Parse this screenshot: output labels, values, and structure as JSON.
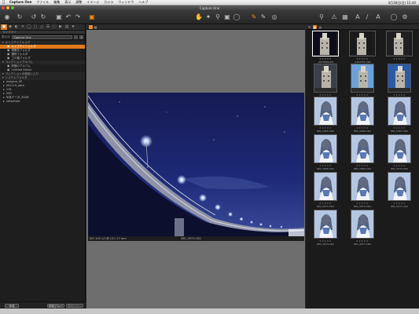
{
  "menubar": {
    "items": [
      "Capture One",
      "ファイル",
      "編集",
      "表示",
      "調整",
      "イメージ",
      "カメラ",
      "ウィンドウ",
      "ヘルプ"
    ],
    "clock": "4月18日(日) 15:40"
  },
  "window": {
    "title": "Capture One"
  },
  "left_panel": {
    "section_label": "ライブラリ",
    "combo_label": "表示元",
    "combo_value": "Capture One",
    "library": [
      {
        "type": "head",
        "label": "キャプチャフォルダ"
      },
      {
        "type": "item",
        "label": "キャプチャフォルダ",
        "selected": true
      },
      {
        "type": "item",
        "label": "現像先フォルダ"
      },
      {
        "type": "item",
        "label": "選択フォルダ"
      },
      {
        "type": "item",
        "label": "ゴミ箱フォルダ"
      },
      {
        "type": "head",
        "label": "コレクションアルバム"
      },
      {
        "type": "item",
        "label": "評価のアルバム"
      },
      {
        "type": "item",
        "label": "Untitled Album"
      },
      {
        "type": "head",
        "label": "コレクションの追加に入力"
      },
      {
        "type": "head",
        "label": "システムフォルダ"
      },
      {
        "type": "tree",
        "label": "imagero_SE"
      },
      {
        "type": "tree",
        "label": "091119_data"
      },
      {
        "type": "tree",
        "label": "278"
      },
      {
        "type": "tree",
        "label": "SSD"
      },
      {
        "type": "tree",
        "label": "写真データ_50GB"
      },
      {
        "type": "tree",
        "label": "netsphoto"
      }
    ],
    "footer": {
      "btn_left": "作成",
      "btn_mid": "削除アルバム",
      "btn_right": "表示リセット"
    }
  },
  "viewer": {
    "info_left": "ISO 100   1/3 秒   f/11   17 mm",
    "info_file": "IMG_5973.CR2"
  },
  "browser": {
    "thumbnails": [
      {
        "caption": "_4SF9699.JPG",
        "selected": true,
        "kind": "night-dark"
      },
      {
        "caption": "_1202331.CR2",
        "kind": "tower-night"
      },
      {
        "caption": "",
        "kind": "building-night"
      },
      {
        "caption": "_1202372.CR2",
        "kind": "building-dusk"
      },
      {
        "caption": "_1502082.CR2",
        "kind": "clock-tower"
      },
      {
        "caption": "",
        "kind": "building-blue"
      },
      {
        "caption": "IMG_5965.CR2",
        "kind": "portrait"
      },
      {
        "caption": "IMG_5966.CR2",
        "kind": "portrait"
      },
      {
        "caption": "IMG_5967.CR2",
        "kind": "portrait"
      },
      {
        "caption": "IMG_5968.CR2",
        "kind": "portrait"
      },
      {
        "caption": "IMG_5969.CR2",
        "kind": "portrait"
      },
      {
        "caption": "IMG_5970.CR2",
        "kind": "portrait"
      },
      {
        "caption": "IMG_5971.CR2",
        "kind": "portrait"
      },
      {
        "caption": "IMG_5972.CR2",
        "kind": "portrait"
      },
      {
        "caption": "IMG_5973.CR2",
        "kind": "portrait"
      },
      {
        "caption": "IMG_5974.CR2",
        "kind": "portrait"
      },
      {
        "caption": "IMG_5977.CR2",
        "kind": "portrait"
      }
    ],
    "stars": "★★★★★"
  },
  "colors": {
    "accent": "#e07a18",
    "sky": "#1e2560",
    "panel": "#1b1b1b"
  },
  "icons": [
    "apple-icon",
    "capture-icon",
    "rotate-left-icon",
    "rotate-right-icon",
    "import-icon",
    "export-icon",
    "hand-icon",
    "zoom-icon",
    "crop-icon",
    "straighten-icon",
    "wb-picker-icon",
    "search-icon",
    "warning-icon",
    "text-icon",
    "brush-icon",
    "gear-icon"
  ]
}
